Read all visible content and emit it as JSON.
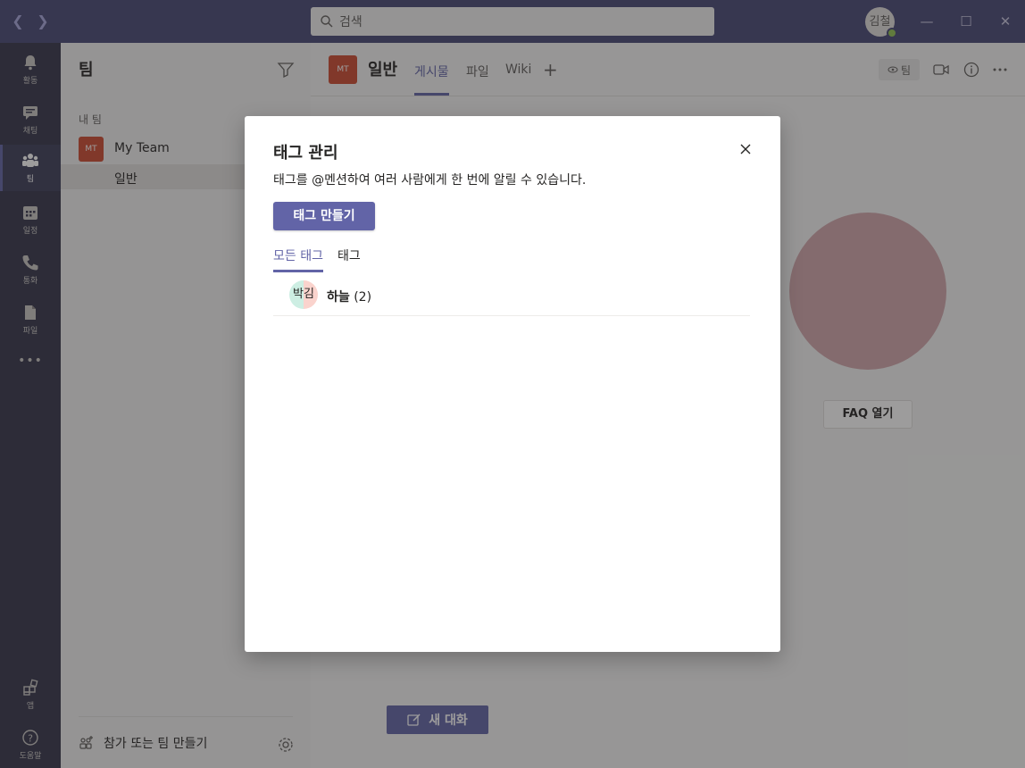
{
  "titlebar": {
    "search_placeholder": "검색",
    "user_initials": "김철",
    "presence_color": "#92c353"
  },
  "rail": {
    "items": [
      {
        "label": "활동",
        "icon": "bell-icon"
      },
      {
        "label": "채팅",
        "icon": "chat-icon"
      },
      {
        "label": "팀",
        "icon": "teams-icon"
      },
      {
        "label": "일정",
        "icon": "calendar-icon"
      },
      {
        "label": "통화",
        "icon": "phone-icon"
      },
      {
        "label": "파일",
        "icon": "file-icon"
      }
    ],
    "more": "•••",
    "bottom": [
      {
        "label": "앱",
        "icon": "apps-icon"
      },
      {
        "label": "도움말",
        "icon": "help-icon"
      }
    ]
  },
  "teams_pane": {
    "title": "팀",
    "section_label": "내 팀",
    "team": {
      "initials": "MT",
      "name": "My Team"
    },
    "channel": "일반",
    "join_label": "참가 또는 팀 만들기"
  },
  "header": {
    "channel_initials": "MT",
    "channel_title": "일반",
    "tabs": [
      "게시물",
      "파일",
      "Wiki"
    ],
    "team_pill": "팀"
  },
  "main": {
    "faq_button": "FAQ 열기",
    "new_conversation": "새 대화"
  },
  "dialog": {
    "title": "태그 관리",
    "description": "태그를 @멘션하여 여러 사람에게 한 번에 알릴 수 있습니다.",
    "create_button": "태그 만들기",
    "tabs": [
      "모든 태그",
      "태그"
    ],
    "tags": [
      {
        "avatar_left": "박",
        "avatar_right": "김",
        "name": "하늘",
        "count": "(2)"
      }
    ]
  },
  "colors": {
    "titlebar": "#464775",
    "rail": "#33344a",
    "accent": "#6264a7",
    "team_avatar": "#cc4a31"
  }
}
